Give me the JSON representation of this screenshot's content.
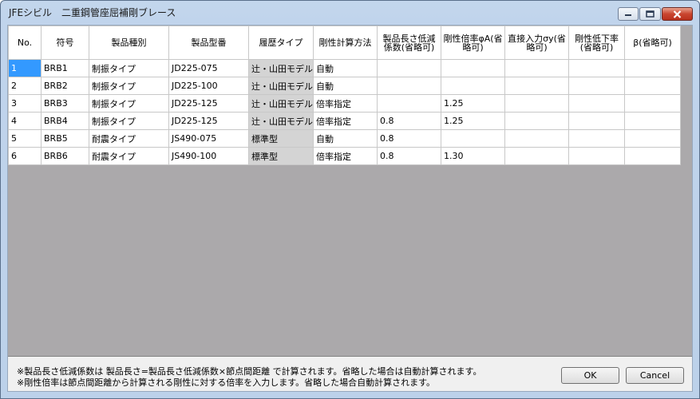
{
  "window": {
    "title": "JFEシビル　二重鋼管座屈補剛ブレース",
    "controls": {
      "minimize": "minimize",
      "maximize": "maximize",
      "close": "close"
    }
  },
  "table": {
    "columns": [
      "No.",
      "符号",
      "製品種別",
      "製品型番",
      "履歴タイプ",
      "剛性計算方法",
      "製品長さ低減係数(省略可)",
      "剛性倍率φA(省略可)",
      "直接入力σy(省略可)",
      "剛性低下率(省略可)",
      "β(省略可)"
    ],
    "rows": [
      {
        "no": "1",
        "code": "BRB1",
        "kind": "制振タイプ",
        "model": "JD225-075",
        "hysteresis": "辻・山田モデル",
        "method": "自動",
        "len_factor": "",
        "phiA": "",
        "sigma_y": "",
        "reduction": "",
        "beta": ""
      },
      {
        "no": "2",
        "code": "BRB2",
        "kind": "制振タイプ",
        "model": "JD225-100",
        "hysteresis": "辻・山田モデル",
        "method": "自動",
        "len_factor": "",
        "phiA": "",
        "sigma_y": "",
        "reduction": "",
        "beta": ""
      },
      {
        "no": "3",
        "code": "BRB3",
        "kind": "制振タイプ",
        "model": "JD225-125",
        "hysteresis": "辻・山田モデル",
        "method": "倍率指定",
        "len_factor": "",
        "phiA": "1.25",
        "sigma_y": "",
        "reduction": "",
        "beta": ""
      },
      {
        "no": "4",
        "code": "BRB4",
        "kind": "制振タイプ",
        "model": "JD225-125",
        "hysteresis": "辻・山田モデル",
        "method": "倍率指定",
        "len_factor": "0.8",
        "phiA": "1.25",
        "sigma_y": "",
        "reduction": "",
        "beta": ""
      },
      {
        "no": "5",
        "code": "BRB5",
        "kind": "耐震タイプ",
        "model": "JS490-075",
        "hysteresis": "標準型",
        "method": "自動",
        "len_factor": "0.8",
        "phiA": "",
        "sigma_y": "",
        "reduction": "",
        "beta": ""
      },
      {
        "no": "6",
        "code": "BRB6",
        "kind": "耐震タイプ",
        "model": "JS490-100",
        "hysteresis": "標準型",
        "method": "倍率指定",
        "len_factor": "0.8",
        "phiA": "1.30",
        "sigma_y": "",
        "reduction": "",
        "beta": ""
      }
    ]
  },
  "notes": [
    "※製品長さ低減係数は 製品長さ=製品長さ低減係数×節点間距離 で計算されます。省略した場合は自動計算されます。",
    "※剛性倍率は節点間距離から計算される剛性に対する倍率を入力します。省略した場合自動計算されます。"
  ],
  "buttons": {
    "ok": "OK",
    "cancel": "Cancel"
  }
}
